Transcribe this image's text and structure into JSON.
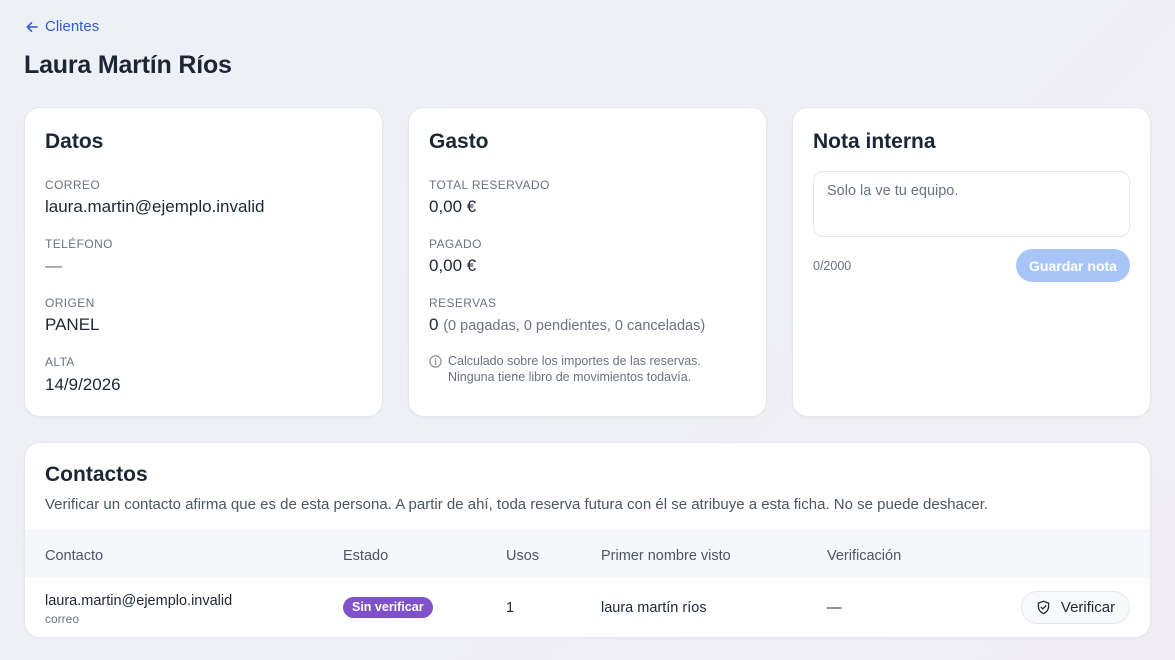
{
  "header": {
    "back_label": "Clientes",
    "title": "Laura Martín Ríos"
  },
  "datos": {
    "title": "Datos",
    "fields": [
      {
        "label": "CORREO",
        "value": "laura.martin@ejemplo.invalid"
      },
      {
        "label": "TELÉFONO",
        "value": "—"
      },
      {
        "label": "ORIGEN",
        "value": "PANEL"
      },
      {
        "label": "ALTA",
        "value": "14/9/2026"
      }
    ]
  },
  "gasto": {
    "title": "Gasto",
    "total_label": "TOTAL RESERVADO",
    "total_value": "0,00 €",
    "paid_label": "PAGADO",
    "paid_value": "0,00 €",
    "bookings_label": "RESERVAS",
    "bookings_count": "0",
    "bookings_breakdown": "(0 pagadas, 0 pendientes, 0 canceladas)",
    "info_line1": "Calculado sobre los importes de las reservas.",
    "info_line2": "Ninguna tiene libro de movimientos todavía."
  },
  "nota": {
    "title": "Nota interna",
    "placeholder": "Solo la ve tu equipo.",
    "value": "",
    "char_count": "0/2000",
    "save_label": "Guardar nota"
  },
  "contactos": {
    "title": "Contactos",
    "description": "Verificar un contacto afirma que es de esta persona. A partir de ahí, toda reserva futura con él se atribuye a esta ficha. No se puede deshacer.",
    "columns": [
      "Contacto",
      "Estado",
      "Usos",
      "Primer nombre visto",
      "Verificación"
    ],
    "rows": [
      {
        "contact": "laura.martin@ejemplo.invalid",
        "type": "correo",
        "status": "Sin verificar",
        "uses": "1",
        "first_name": "laura martín ríos",
        "verification": "—",
        "action_label": "Verificar"
      }
    ]
  },
  "colors": {
    "accent": "#2f5bd2",
    "save_button_disabled": "#a7c6f7",
    "badge_unverified": "#8151c9"
  },
  "icons": [
    "arrow-left-icon",
    "info-icon",
    "shield-check-icon"
  ]
}
